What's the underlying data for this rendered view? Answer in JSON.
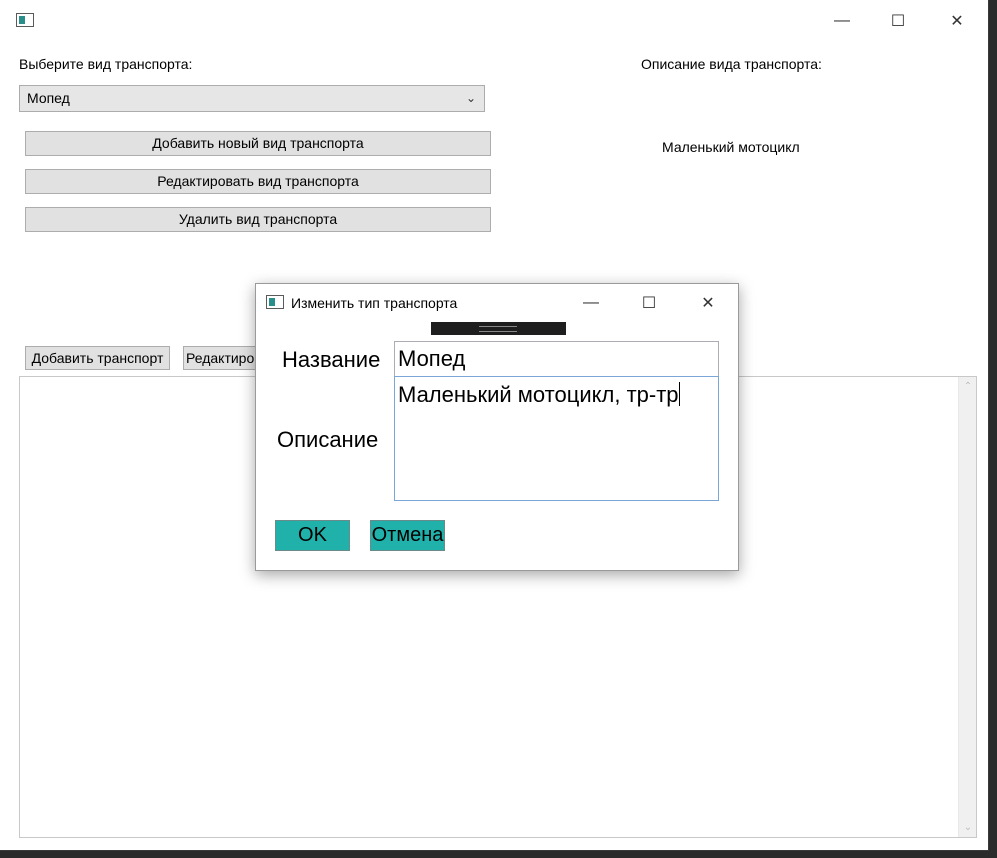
{
  "main": {
    "title": "",
    "select_label": "Выберите вид транспорта:",
    "selected_type": "Мопед",
    "description_label": "Описание вида транспорта:",
    "description_value": "Маленький мотоцикл",
    "buttons": {
      "add_type": "Добавить новый вид транспорта",
      "edit_type": "Редактировать вид транспорта",
      "delete_type": "Удалить вид транспорта",
      "add_transport": "Добавить транспорт",
      "edit_transport": "Редактиро"
    }
  },
  "window_controls": {
    "minimize": "—",
    "maximize": "☐",
    "close": "✕"
  },
  "dialog": {
    "title": "Изменить тип транспорта",
    "name_label": "Название",
    "name_value": "Мопед",
    "description_label": "Описание",
    "description_value": "Маленький мотоцикл, тр-тр",
    "ok_label": "OK",
    "cancel_label": "Отмена",
    "colors": {
      "button_bg": "#20b2aa",
      "focus_border": "#7aa7d8"
    }
  },
  "icons": [
    "app-icon",
    "chevron-down-icon",
    "minimize-icon",
    "maximize-icon",
    "close-icon",
    "scroll-up-icon",
    "scroll-down-icon"
  ]
}
